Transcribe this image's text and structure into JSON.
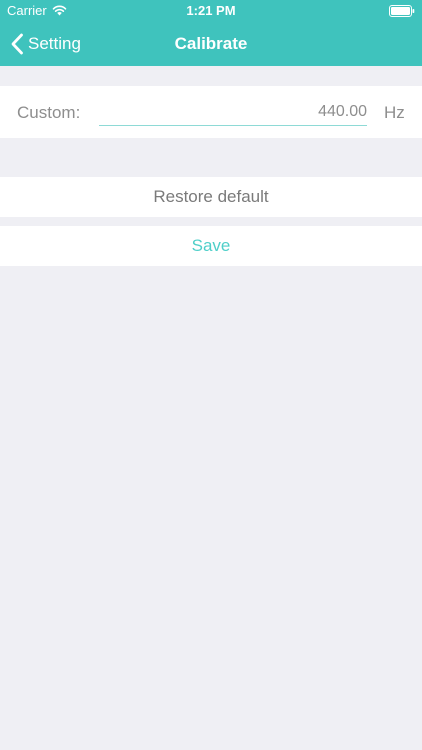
{
  "status_bar": {
    "carrier": "Carrier",
    "time": "1:21 PM",
    "wifi_icon": "wifi-icon",
    "battery_icon": "battery-full-icon"
  },
  "nav": {
    "back_label": "Setting",
    "back_icon": "chevron-left-icon",
    "title": "Calibrate"
  },
  "custom": {
    "label": "Custom:",
    "value": "440.00",
    "unit": "Hz"
  },
  "actions": {
    "restore_label": "Restore default",
    "save_label": "Save"
  },
  "colors": {
    "accent": "#3fc3bd",
    "save_text": "#4fcfc9",
    "background": "#efeff4",
    "muted_text": "#8e8e8e"
  }
}
